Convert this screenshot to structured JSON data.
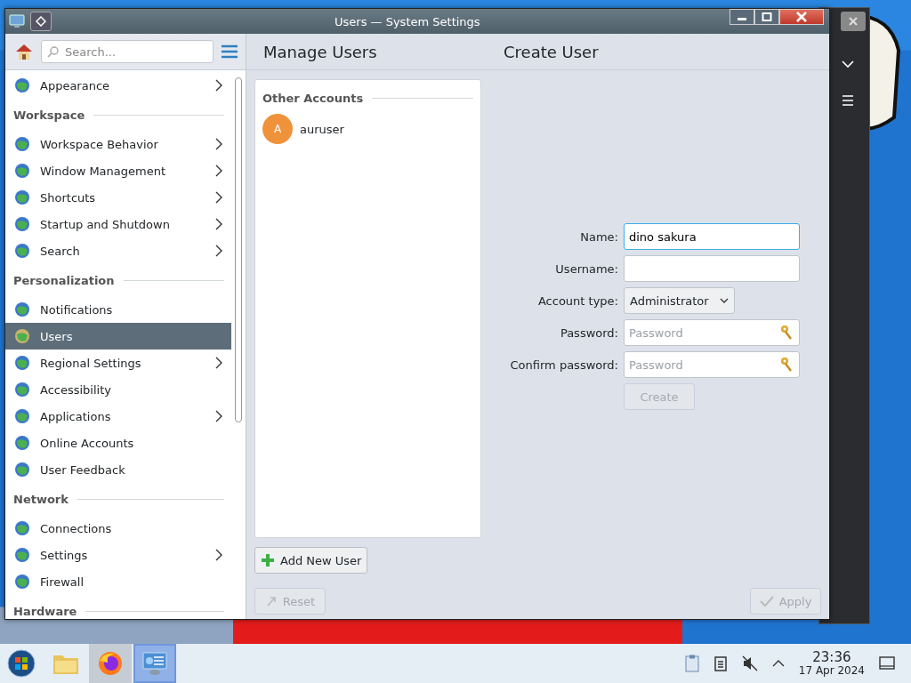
{
  "window": {
    "title": "Users — System Settings"
  },
  "sidebar": {
    "search": {
      "placeholder": "Search..."
    },
    "sections": [
      {
        "items": [
          {
            "label": "Appearance",
            "selected": false,
            "expandable": true
          }
        ]
      },
      {
        "header": "Workspace",
        "items": [
          {
            "label": "Workspace Behavior",
            "selected": false,
            "expandable": true
          },
          {
            "label": "Window Management",
            "selected": false,
            "expandable": true
          },
          {
            "label": "Shortcuts",
            "selected": false,
            "expandable": true
          },
          {
            "label": "Startup and Shutdown",
            "selected": false,
            "expandable": true
          },
          {
            "label": "Search",
            "selected": false,
            "expandable": true
          }
        ]
      },
      {
        "header": "Personalization",
        "items": [
          {
            "label": "Notifications",
            "selected": false,
            "expandable": false
          },
          {
            "label": "Users",
            "selected": true,
            "expandable": false
          },
          {
            "label": "Regional Settings",
            "selected": false,
            "expandable": true
          },
          {
            "label": "Accessibility",
            "selected": false,
            "expandable": false
          },
          {
            "label": "Applications",
            "selected": false,
            "expandable": true
          },
          {
            "label": "Online Accounts",
            "selected": false,
            "expandable": false
          },
          {
            "label": "User Feedback",
            "selected": false,
            "expandable": false
          }
        ]
      },
      {
        "header": "Network",
        "items": [
          {
            "label": "Connections",
            "selected": false,
            "expandable": false
          },
          {
            "label": "Settings",
            "selected": false,
            "expandable": true
          },
          {
            "label": "Firewall",
            "selected": false,
            "expandable": false
          }
        ]
      },
      {
        "header": "Hardware"
      }
    ]
  },
  "manage_users": {
    "title": "Manage Users",
    "list_header": "Other Accounts",
    "users": [
      {
        "initial": "A",
        "name": "auruser",
        "selected": false
      }
    ],
    "add_button": "Add New User"
  },
  "create_user": {
    "title": "Create User",
    "fields": [
      {
        "kind": "text",
        "label": "Name:",
        "value": "dino sakura",
        "focused": true
      },
      {
        "kind": "text",
        "label": "Username:",
        "focused": false
      },
      {
        "kind": "select",
        "label": "Account type:",
        "value": "Administrator"
      },
      {
        "kind": "password",
        "label": "Password:",
        "placeholder": "Password",
        "focused": false
      },
      {
        "kind": "password",
        "label": "Confirm password:",
        "placeholder": "Password",
        "focused": false
      }
    ],
    "create_button": {
      "label": "Create",
      "disabled": true
    }
  },
  "footer": {
    "reset": {
      "label": "Reset",
      "disabled": true
    },
    "apply": {
      "label": "Apply",
      "disabled": true
    }
  },
  "taskbar": {
    "apps": [
      {
        "kind": "start",
        "selected": false,
        "hovered": false
      },
      {
        "kind": "files",
        "selected": false,
        "hovered": false
      },
      {
        "kind": "browser",
        "selected": false,
        "hovered": true
      },
      {
        "kind": "settings",
        "selected": true,
        "hovered": false
      }
    ],
    "clock": {
      "time": "23:36",
      "date": "17 Apr 2024"
    }
  }
}
